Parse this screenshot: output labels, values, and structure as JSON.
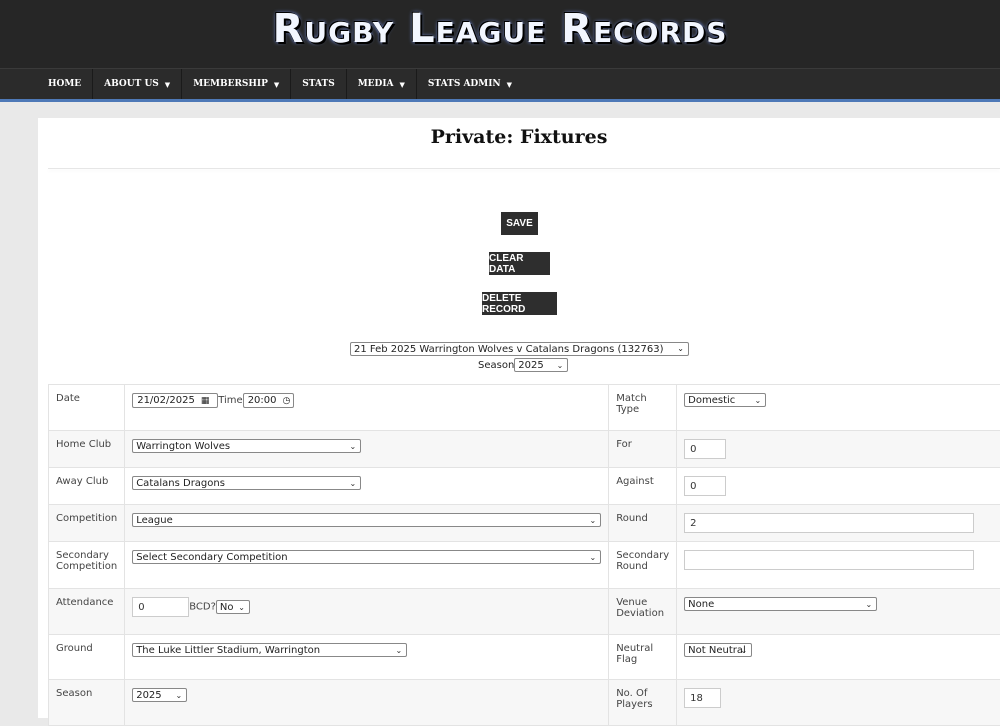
{
  "site": {
    "title": "Rugby League Records"
  },
  "nav": [
    {
      "label": "HOME",
      "caret": false
    },
    {
      "label": "ABOUT US",
      "caret": true
    },
    {
      "label": "MEMBERSHIP",
      "caret": true
    },
    {
      "label": "STATS",
      "caret": false
    },
    {
      "label": "MEDIA",
      "caret": true
    },
    {
      "label": "STATS ADMIN",
      "caret": true
    }
  ],
  "page": {
    "title": "Private: Fixtures"
  },
  "buttons": {
    "save": "SAVE",
    "clear": "CLEAR DATA",
    "delete": "DELETE RECORD"
  },
  "record_select": {
    "value": "21 Feb 2025 Warrington Wolves v Catalans Dragons (132763)"
  },
  "season_filter": {
    "label": "Season",
    "value": "2025"
  },
  "form": {
    "date": {
      "label": "Date",
      "value": "21/02/2025",
      "time_label": "Time",
      "time_value": "20:00"
    },
    "match_type": {
      "label": "Match Type",
      "value": "Domestic"
    },
    "home_club": {
      "label": "Home Club",
      "value": "Warrington Wolves"
    },
    "for": {
      "label": "For",
      "value": "0"
    },
    "away_club": {
      "label": "Away Club",
      "value": "Catalans Dragons"
    },
    "against": {
      "label": "Against",
      "value": "0"
    },
    "competition": {
      "label": "Competition",
      "value": "League"
    },
    "round": {
      "label": "Round",
      "value": "2"
    },
    "secondary_competition": {
      "label": "Secondary Competition",
      "value": "Select Secondary Competition"
    },
    "secondary_round": {
      "label": "Secondary Round",
      "value": ""
    },
    "attendance": {
      "label": "Attendance",
      "value": "0",
      "bcd_label": "BCD?",
      "bcd_value": "No"
    },
    "venue_deviation": {
      "label": "Venue Deviation",
      "value": "None"
    },
    "ground": {
      "label": "Ground",
      "value": "The Luke Littler Stadium, Warrington"
    },
    "neutral_flag": {
      "label": "Neutral Flag",
      "value": "Not Neutral"
    },
    "season": {
      "label": "Season",
      "value": "2025"
    },
    "no_of_players": {
      "label": "No. Of Players",
      "value": "18"
    }
  }
}
